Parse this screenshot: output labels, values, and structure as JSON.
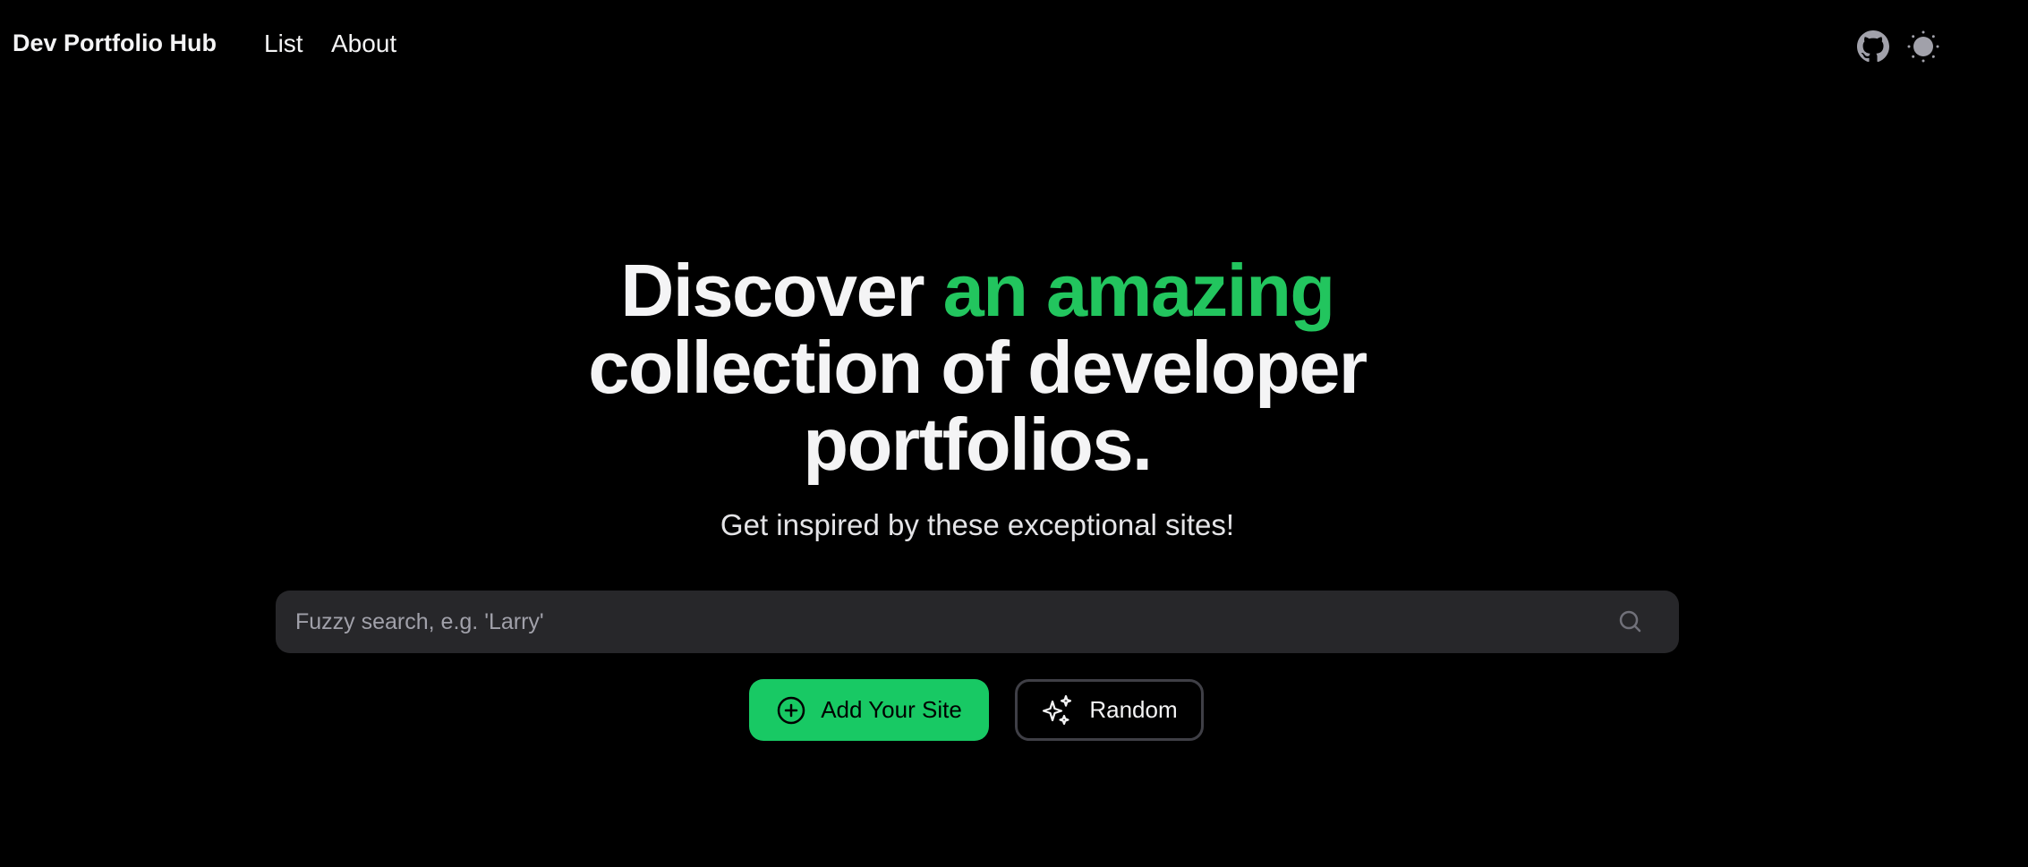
{
  "nav": {
    "brand": "Dev Portfolio Hub",
    "links": [
      {
        "label": "List"
      },
      {
        "label": "About"
      }
    ],
    "icons": {
      "github": "github-icon",
      "theme": "sun-icon"
    }
  },
  "hero": {
    "headline_plain_1": "Discover ",
    "headline_accent": "an amazing",
    "headline_plain_2": "collection of developer portfolios.",
    "subtitle": "Get inspired by these exceptional sites!"
  },
  "search": {
    "placeholder": "Fuzzy search, e.g. 'Larry'",
    "value": ""
  },
  "actions": {
    "add_label": "Add Your Site",
    "random_label": "Random"
  },
  "colors": {
    "accent": "#22c55e",
    "button_green": "#18c964",
    "background": "#000000",
    "search_bg": "#27272a"
  }
}
